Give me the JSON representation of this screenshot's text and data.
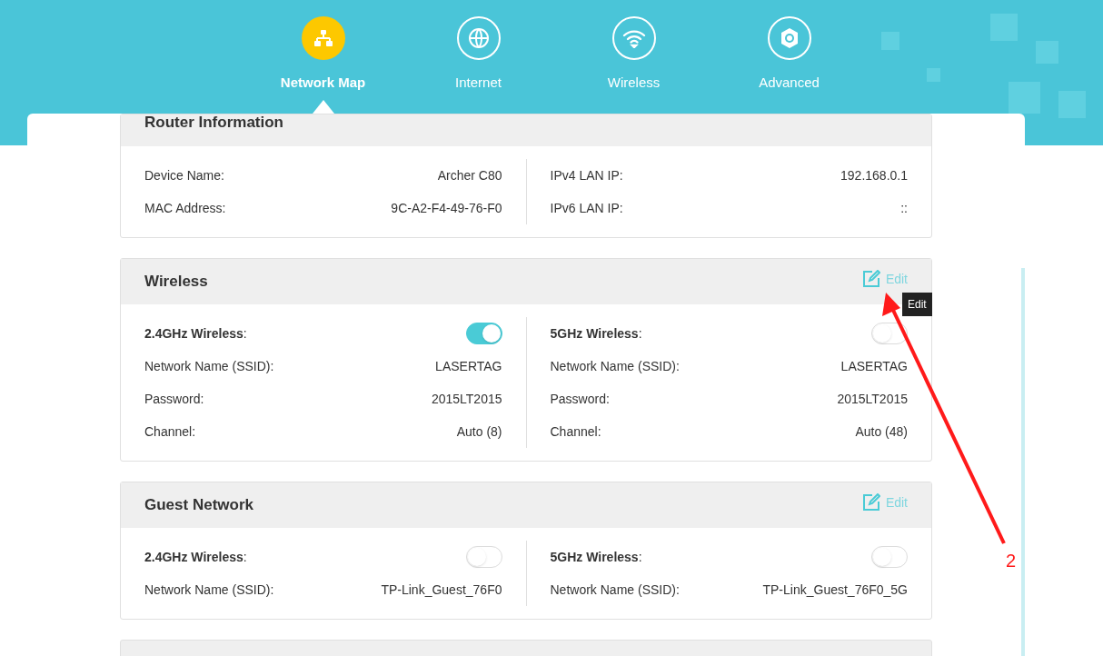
{
  "nav": [
    {
      "label": "Network Map",
      "selected": true
    },
    {
      "label": "Internet",
      "selected": false
    },
    {
      "label": "Wireless",
      "selected": false
    },
    {
      "label": "Advanced",
      "selected": false
    }
  ],
  "sections": [
    {
      "title": "Router Information",
      "columns": [
        [
          {
            "kind": "field",
            "label": "Device Name:",
            "value": "Archer C80"
          },
          {
            "kind": "field",
            "label": "MAC Address:",
            "value": "9C-A2-F4-49-76-F0"
          }
        ],
        [
          {
            "kind": "field",
            "label": "IPv4 LAN IP:",
            "value": "192.168.0.1"
          },
          {
            "kind": "field",
            "label": "IPv6 LAN IP:",
            "value": "::"
          }
        ]
      ]
    },
    {
      "title": "Wireless",
      "edit": "Edit",
      "columns": [
        [
          {
            "kind": "toggle",
            "label": "**2.4GHz Wireless**:",
            "on": true
          },
          {
            "kind": "field",
            "label": "Network Name (SSID):",
            "value": "LASERTAG"
          },
          {
            "kind": "field",
            "label": "Password:",
            "value": "2015LT2015"
          },
          {
            "kind": "field",
            "label": "Channel:",
            "value": "Auto (8)"
          }
        ],
        [
          {
            "kind": "toggle",
            "label": "**5GHz Wireless**:",
            "on": false
          },
          {
            "kind": "field",
            "label": "Network Name (SSID):",
            "value": "LASERTAG"
          },
          {
            "kind": "field",
            "label": "Password:",
            "value": "2015LT2015"
          },
          {
            "kind": "field",
            "label": "Channel:",
            "value": "Auto (48)"
          }
        ]
      ]
    },
    {
      "title": "Guest Network",
      "edit": "Edit",
      "columns": [
        [
          {
            "kind": "toggle",
            "label": "**2.4GHz Wireless**:",
            "on": false
          },
          {
            "kind": "field",
            "label": "Network Name (SSID):",
            "value": "TP-Link_Guest_76F0"
          }
        ],
        [
          {
            "kind": "toggle",
            "label": "**5GHz Wireless**:",
            "on": false
          },
          {
            "kind": "field",
            "label": "Network Name (SSID):",
            "value": "TP-Link_Guest_76F0_5G"
          }
        ]
      ]
    }
  ],
  "tooltip": {
    "text": "Edit"
  },
  "annotation": {
    "label": "2"
  }
}
